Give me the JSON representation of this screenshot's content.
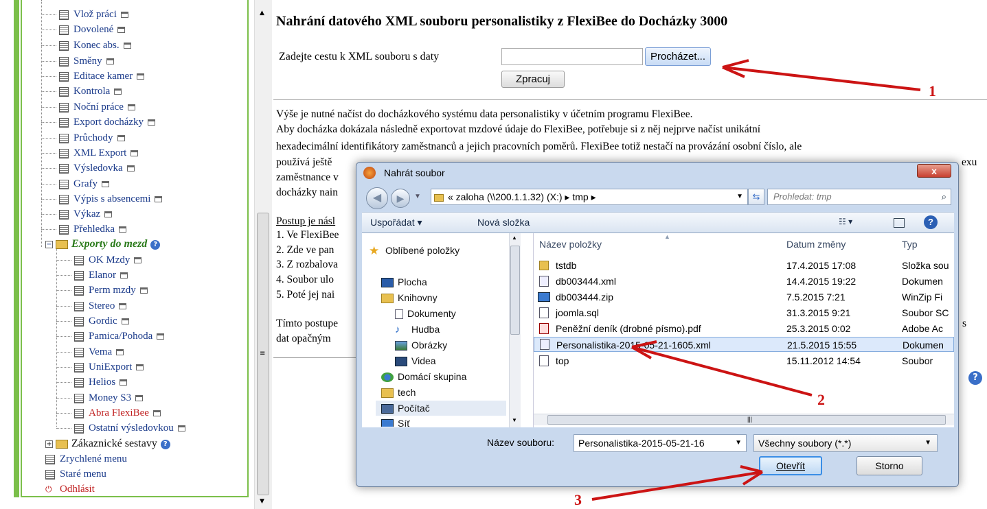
{
  "tree": {
    "items": [
      {
        "label": "Vlož práci"
      },
      {
        "label": "Dovolené"
      },
      {
        "label": "Konec abs."
      },
      {
        "label": "Směny"
      },
      {
        "label": "Editace kamer"
      },
      {
        "label": "Kontrola"
      },
      {
        "label": "Noční práce"
      },
      {
        "label": "Export docházky"
      },
      {
        "label": "Průchody"
      },
      {
        "label": "XML Export"
      },
      {
        "label": "Výsledovka"
      },
      {
        "label": "Grafy"
      },
      {
        "label": "Výpis s absencemi"
      },
      {
        "label": "Výkaz"
      },
      {
        "label": "Přehledka"
      }
    ],
    "exports_folder": "Exporty do mezd",
    "export_items": [
      {
        "label": "OK Mzdy"
      },
      {
        "label": "Elanor"
      },
      {
        "label": "Perm mzdy"
      },
      {
        "label": "Stereo"
      },
      {
        "label": "Gordic"
      },
      {
        "label": "Pamica/Pohoda"
      },
      {
        "label": "Vema"
      },
      {
        "label": "UniExport"
      },
      {
        "label": "Helios"
      },
      {
        "label": "Money S3"
      },
      {
        "label": "Abra FlexiBee"
      },
      {
        "label": "Ostatní výsledovkou"
      }
    ],
    "customer_folder": "Zákaznické sestavy",
    "quick_menu": "Zrychlené menu",
    "old_menu": "Staré menu",
    "logout": "Odhlásit",
    "colors": {
      "link": "#1a3a8a",
      "active": "#c02020",
      "folder_italic": "#2a7a1a"
    }
  },
  "main": {
    "title": "Nahrání datového XML souboru personalistiky z FlexiBee do Docházky 3000",
    "path_label": "Zadejte cestu k XML souboru s daty",
    "browse_label": "Procházet...",
    "process_label": "Zpracuj",
    "paragraphs": [
      "Výše je nutné načíst do docházkového systému data personalistiky v účetním programu FlexiBee.",
      "Aby docházka dokázala následně exportovat mzdové údaje do FlexiBee, potřebuje si z něj nejprve načíst unikátní",
      "hexadecimální identifikátory zaměstnanců a jejich pracovních poměrů. FlexiBee totiž nestačí na provázání osobní číslo, ale",
      "používá ještě",
      "zaměstnance v",
      "docházky nain"
    ],
    "partial_right": [
      "exu"
    ],
    "steps_heading": "Postup je násl",
    "steps": [
      "1. Ve FlexiBee",
      "2. Zde ve pan",
      "3. Z rozbalova",
      "4. Soubor ulo",
      "5. Poté jej nai"
    ],
    "footer_lines": [
      "Tímto postupe",
      "dat opačným"
    ],
    "footer_right": "s"
  },
  "dialog": {
    "title": "Nahrát soubor",
    "close_label": "x",
    "address": "« zaloha (\\\\200.1.1.32) (X:) ▸ tmp ▸",
    "search_placeholder": "Prohledat: tmp",
    "toolbar": {
      "organize": "Uspořádat ▾",
      "new_folder": "Nová složka"
    },
    "nav": [
      {
        "label": "Oblíbené položky",
        "icon": "star-icon"
      },
      {
        "label": "Plocha",
        "icon": "desktop-icon"
      },
      {
        "label": "Knihovny",
        "icon": "library-icon"
      },
      {
        "label": "Dokumenty",
        "icon": "documents-icon"
      },
      {
        "label": "Hudba",
        "icon": "music-icon"
      },
      {
        "label": "Obrázky",
        "icon": "pictures-icon"
      },
      {
        "label": "Videa",
        "icon": "video-icon"
      },
      {
        "label": "Domácí skupina",
        "icon": "homegroup-icon"
      },
      {
        "label": "tech",
        "icon": "user-folder-icon"
      },
      {
        "label": "Počítač",
        "icon": "computer-icon"
      },
      {
        "label": "Síť",
        "icon": "network-icon"
      }
    ],
    "columns": {
      "name": "Název položky",
      "date": "Datum změny",
      "type": "Typ"
    },
    "files": [
      {
        "name": "tstdb",
        "date": "17.4.2015 17:08",
        "type": "Složka sou",
        "icon": "folder-icon"
      },
      {
        "name": "db003444.xml",
        "date": "14.4.2015 19:22",
        "type": "Dokumen",
        "icon": "xml-file-icon"
      },
      {
        "name": "db003444.zip",
        "date": "7.5.2015 7:21",
        "type": "WinZip Fi",
        "icon": "zip-file-icon"
      },
      {
        "name": "joomla.sql",
        "date": "31.3.2015 9:21",
        "type": "Soubor SC",
        "icon": "file-icon"
      },
      {
        "name": "Peněžní deník (drobné písmo).pdf",
        "date": "25.3.2015 0:02",
        "type": "Adobe Ac",
        "icon": "pdf-file-icon"
      },
      {
        "name": "Personalistika-2015-05-21-1605.xml",
        "date": "21.5.2015 15:55",
        "type": "Dokumen",
        "icon": "xml-file-icon"
      },
      {
        "name": "top",
        "date": "15.11.2012 14:54",
        "type": "Soubor",
        "icon": "file-icon"
      }
    ],
    "filename_label": "Název souboru:",
    "filename_value": "Personalistika-2015-05-21-16",
    "filetype_value": "Všechny soubory (*.*)",
    "open_label": "Otevřít",
    "cancel_label": "Storno"
  },
  "annotations": {
    "one": "1",
    "two": "2",
    "three": "3",
    "color": "#cc1414"
  }
}
